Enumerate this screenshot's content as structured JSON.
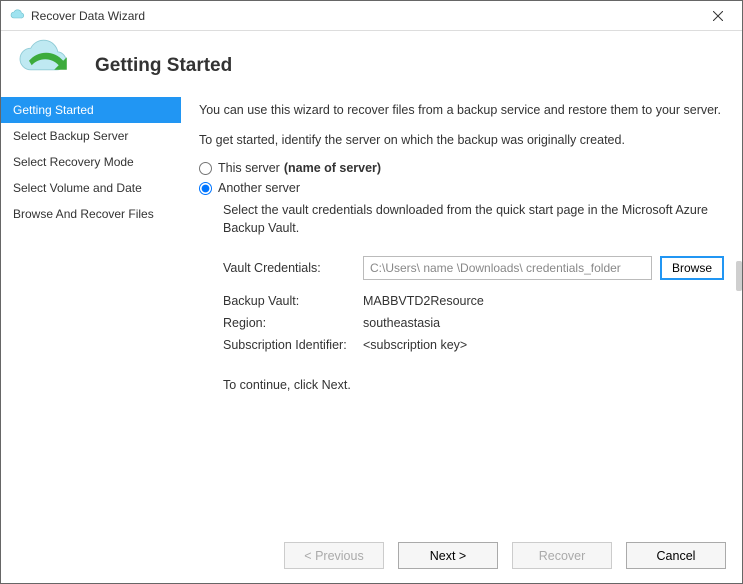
{
  "window": {
    "title": "Recover Data Wizard"
  },
  "header": {
    "title": "Getting Started"
  },
  "sidebar": {
    "steps": [
      {
        "label": "Getting Started",
        "active": true
      },
      {
        "label": "Select Backup Server",
        "active": false
      },
      {
        "label": "Select Recovery Mode",
        "active": false
      },
      {
        "label": "Select Volume and Date",
        "active": false
      },
      {
        "label": "Browse And Recover Files",
        "active": false
      }
    ]
  },
  "content": {
    "intro": "You can use this wizard to recover files from a backup service and restore them to your server.",
    "identify": "To get started, identify the server on which the backup was originally created.",
    "radio_this_label": "This server",
    "radio_this_suffix": "(name of server)",
    "radio_another_label": "Another server",
    "selected": "another",
    "vault_instructions": "Select the vault credentials downloaded from the quick start page in the Microsoft Azure Backup Vault.",
    "vc_label": "Vault Credentials:",
    "vc_value": "C:\\Users\\ name \\Downloads\\ credentials_folder",
    "browse_label": "Browse",
    "backup_vault_label": "Backup Vault:",
    "backup_vault_value": "MABBVTD2Resource",
    "region_label": "Region:",
    "region_value": "southeastasia",
    "sub_id_label": "Subscription Identifier:",
    "sub_id_value": "<subscription key>",
    "continue_hint": "To continue, click Next."
  },
  "footer": {
    "previous": "< Previous",
    "next": "Next >",
    "recover": "Recover",
    "cancel": "Cancel"
  }
}
